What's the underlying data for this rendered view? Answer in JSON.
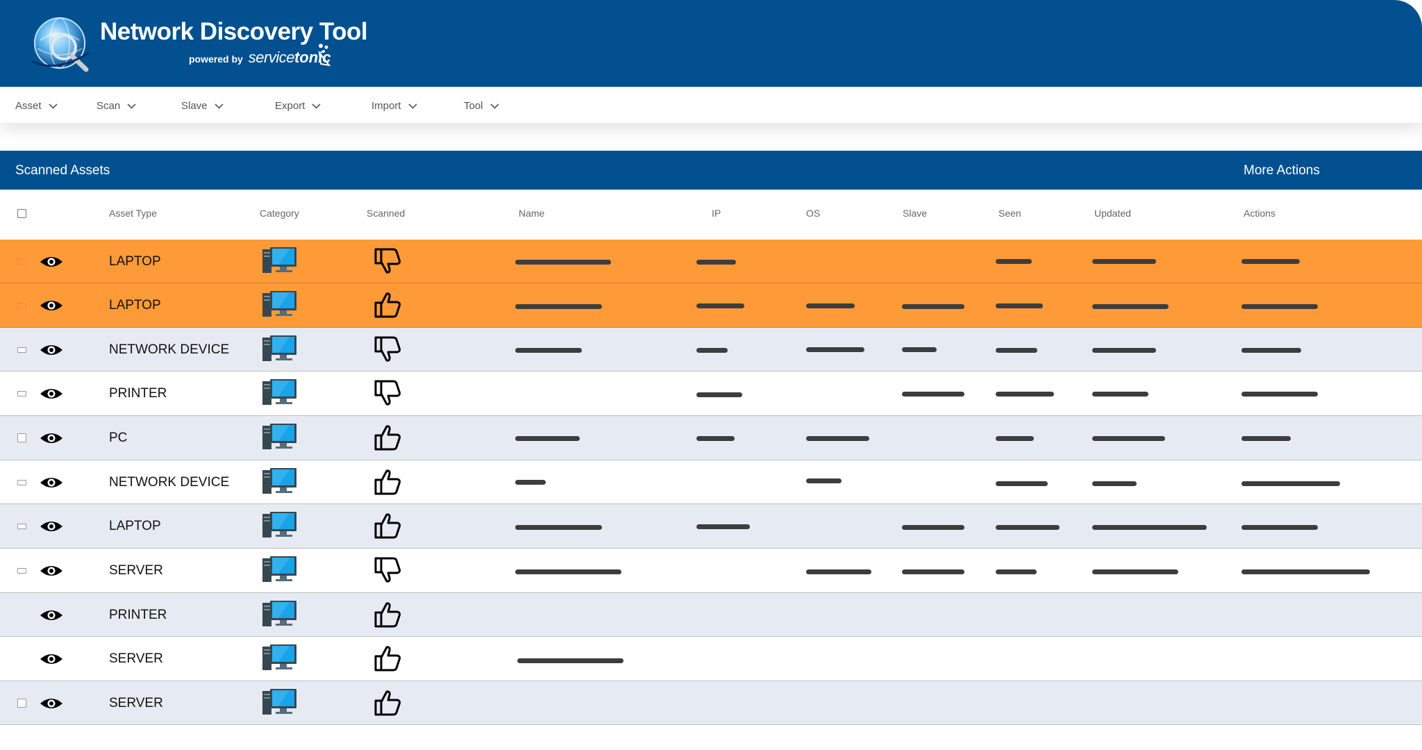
{
  "app": {
    "title": "Network Discovery Tool",
    "powered_by": "powered by",
    "brand_service": "service",
    "brand_tonic": "tonic"
  },
  "menu": [
    {
      "label": "Asset",
      "icon": "chevron-down-icon"
    },
    {
      "label": "Scan",
      "icon": "chevron-down-icon"
    },
    {
      "label": "Slave",
      "icon": "chevron-down-icon"
    },
    {
      "label": "Export",
      "icon": "chevron-down-icon"
    },
    {
      "label": "Import",
      "icon": "chevron-down-icon"
    },
    {
      "label": "Tool",
      "icon": "chevron-down-icon"
    }
  ],
  "panel": {
    "title": "Scanned Assets",
    "more_actions": "More Actions"
  },
  "table": {
    "columns": [
      "Asset Type",
      "Category",
      "Scanned",
      "Name",
      "IP",
      "OS",
      "Slave",
      "Seen",
      "Updated",
      "Actions"
    ],
    "rows": [
      {
        "asset_type": "LAPTOP",
        "scanned": "thumbs-down",
        "style": "highlight"
      },
      {
        "asset_type": "LAPTOP",
        "scanned": "thumbs-up",
        "style": "highlight"
      },
      {
        "asset_type": "NETWORK DEVICE",
        "scanned": "thumbs-down",
        "style": "alt"
      },
      {
        "asset_type": "PRINTER",
        "scanned": "thumbs-down",
        "style": "plain"
      },
      {
        "asset_type": "PC",
        "scanned": "thumbs-up",
        "style": "alt"
      },
      {
        "asset_type": "NETWORK DEVICE",
        "scanned": "thumbs-up",
        "style": "plain"
      },
      {
        "asset_type": "LAPTOP",
        "scanned": "thumbs-up",
        "style": "alt"
      },
      {
        "asset_type": "SERVER",
        "scanned": "thumbs-down",
        "style": "plain"
      },
      {
        "asset_type": "PRINTER",
        "scanned": "thumbs-up",
        "style": "alt"
      },
      {
        "asset_type": "SERVER",
        "scanned": "thumbs-up",
        "style": "plain"
      },
      {
        "asset_type": "SERVER",
        "scanned": "thumbs-up",
        "style": "alt"
      }
    ]
  },
  "colors": {
    "brand_blue": "#02508f",
    "highlight_orange": "#fe9a37",
    "alt_row": "#e6ebf3",
    "monitor_blue": "#1aa3e8"
  }
}
